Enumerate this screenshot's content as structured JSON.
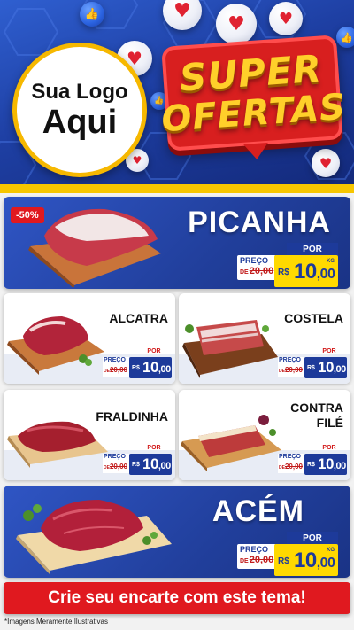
{
  "header": {
    "logo_line1": "Sua Logo",
    "logo_line2": "Aqui",
    "promo_word1": "SUPER",
    "promo_word2": "OFERTAS"
  },
  "featured": {
    "discount": "-50%",
    "name": "PICANHA",
    "price": {
      "por": "POR",
      "preco": "PREÇO",
      "de": "DE",
      "old": "20,00",
      "currency": "R$",
      "value": "10",
      "cents": ",00",
      "unit": "KG"
    }
  },
  "products": [
    {
      "name": "ALCATRA",
      "price": {
        "por": "POR",
        "preco": "PREÇO",
        "de": "DE",
        "old": "20,00",
        "currency": "R$",
        "value": "10",
        "cents": ",00"
      }
    },
    {
      "name": "COSTELA",
      "price": {
        "por": "POR",
        "preco": "PREÇO",
        "de": "DE",
        "old": "20,00",
        "currency": "R$",
        "value": "10",
        "cents": ",00"
      }
    },
    {
      "name": "FRALDINHA",
      "price": {
        "por": "POR",
        "preco": "PREÇO",
        "de": "DE",
        "old": "20,00",
        "currency": "R$",
        "value": "10",
        "cents": ",00"
      }
    },
    {
      "name_line1": "CONTRA",
      "name_line2": "FILÉ",
      "price": {
        "por": "POR",
        "preco": "PREÇO",
        "de": "DE",
        "old": "20,00",
        "currency": "R$",
        "value": "10",
        "cents": ",00"
      }
    }
  ],
  "bottom_featured": {
    "name": "ACÉM",
    "price": {
      "por": "POR",
      "preco": "PREÇO",
      "de": "DE",
      "old": "20,00",
      "currency": "R$",
      "value": "10",
      "cents": ",00",
      "unit": "KG"
    }
  },
  "cta": {
    "label": "Crie seu encarte com este tema!"
  },
  "footnote": "*Imagens Meramente Ilustrativas",
  "colors": {
    "brand_blue": "#213f9c",
    "accent_red": "#e0191f",
    "accent_yellow": "#ffd900"
  }
}
